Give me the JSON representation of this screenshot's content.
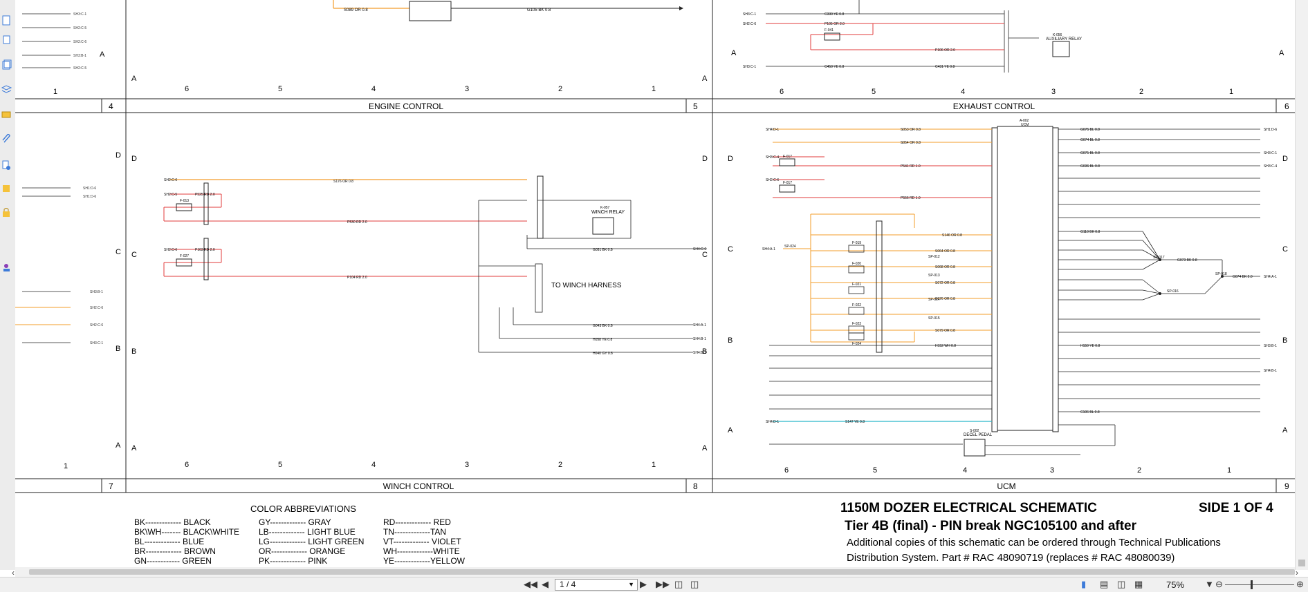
{
  "sheet": {
    "headers": [
      {
        "text": "4"
      },
      {
        "text": "ENGINE CONTROL"
      },
      {
        "text": "5"
      },
      {
        "text": "EXHAUST CONTROL"
      },
      {
        "text": "6"
      },
      {
        "text": "7"
      },
      {
        "text": "WINCH CONTROL"
      },
      {
        "text": "8"
      },
      {
        "text": "UCM"
      },
      {
        "text": "9"
      }
    ],
    "col_numbers": [
      "6",
      "5",
      "4",
      "3",
      "2",
      "1"
    ],
    "row_letters": [
      "A",
      "B",
      "C",
      "D"
    ],
    "labels": {
      "winch_harness": "TO WINCH HARNESS",
      "winch_relay": "WINCH RELAY",
      "winch_relay_id": "K-057",
      "aux_relay": "AUXILIARY RELAY",
      "aux_relay_id": "K-056",
      "ucm_id": "A-002",
      "ucm_name": "UCM",
      "decel_pedal": "DECEL PEDAL",
      "decel_id": "S-002"
    },
    "wire_labels_engine": [
      "S089 OR 0.8",
      "G105 BK 0.8"
    ],
    "wire_labels_exhaust": [
      "C330 YE 0.8",
      "P105 OR 2.0",
      "P106 OR 2.0",
      "C450 YE 0.8",
      "C431 YE 0.8"
    ],
    "wire_labels_winch": [
      "S176 OR 0.8",
      "P525 RD 2.0",
      "P530 RD 2.0",
      "P103 RD 2.0",
      "P104 RD 2.0",
      "G051 BK 0.8",
      "G043 BK 0.8",
      "H058 YE 0.8",
      "H040 GY 0.8"
    ],
    "wire_labels_ucm_left": [
      "S053 OR 0.8",
      "S054 OR 0.8",
      "P541 RD 1.0",
      "P556 RD 1.0",
      "S146 OR 0.8",
      "S064 OR 0.8",
      "S068 OR 0.8",
      "S072 OR 0.8",
      "S076 OR 0.8",
      "S079 OR 0.8",
      "H152 WH 0.8",
      "S147 YE 0.8"
    ],
    "wire_labels_ucm_right": [
      "G075 BL 0.8",
      "G074 BL 0.8",
      "G071 BL 0.8",
      "G036 BL 0.8",
      "G110 BK 0.8",
      "G073 BK 0.8",
      "G074 BK 2.0",
      "H150 YE 0.8",
      "C106 BL 0.8"
    ],
    "connectors": [
      "SH1:D-6",
      "SH3:C-1",
      "SH2:C-6",
      "SH2:C-5",
      "SH4:C-6",
      "SH4:A-1",
      "SH4:B-1",
      "SH3:B-1",
      "SH4:D-1",
      "SH3:C-4"
    ],
    "fuses": [
      "F-013",
      "F-027",
      "F-041",
      "F-017",
      "F-019",
      "F-020",
      "F-021",
      "F-022",
      "F-023",
      "F-024"
    ],
    "splices": [
      "SP-012",
      "SP-013",
      "SP-014",
      "SP-015",
      "SP-016",
      "SP-017",
      "SP-018",
      "SP-024"
    ],
    "color_abbrev_title": "COLOR ABBREVIATIONS",
    "color_abbrev": [
      [
        "BK------------- BLACK",
        "GY------------- GRAY",
        "RD------------- RED"
      ],
      [
        "BK\\WH------- BLACK\\WHITE",
        "LB------------- LIGHT BLUE",
        "TN-------------TAN"
      ],
      [
        "BL------------- BLUE",
        "LG------------- LIGHT GREEN",
        "VT------------- VIOLET"
      ],
      [
        "BR------------- BROWN",
        "OR------------- ORANGE",
        "WH-------------WHITE"
      ],
      [
        "GN------------  GREEN",
        "PK------------- PINK",
        "YE-------------YELLOW"
      ]
    ],
    "title_main": "1150M DOZER ELECTRICAL SCHEMATIC",
    "side": "SIDE 1 OF 4",
    "tier": "Tier 4B (final)   - PIN break NGC105100 and after",
    "copies_line1": "Additional copies of this schematic can be ordered through Technical Publications",
    "copies_line2": "Distribution System.  Part # RAC 48090719 (replaces # RAC 48080039)"
  },
  "statusbar": {
    "page_field": "1 / 4",
    "zoom": "75%"
  },
  "sidebar_icons": [
    "page-icon",
    "pages-icon",
    "layers-icon",
    "attachment-icon",
    "signature-icon",
    "bookmark-icon",
    "clip-icon",
    "search-doc-icon",
    "lock-icon",
    "stamp-icon"
  ],
  "colors": {
    "orange": "#f39c2a",
    "red": "#e23b3b",
    "cyan": "#2bb6c9",
    "black": "#222222"
  }
}
